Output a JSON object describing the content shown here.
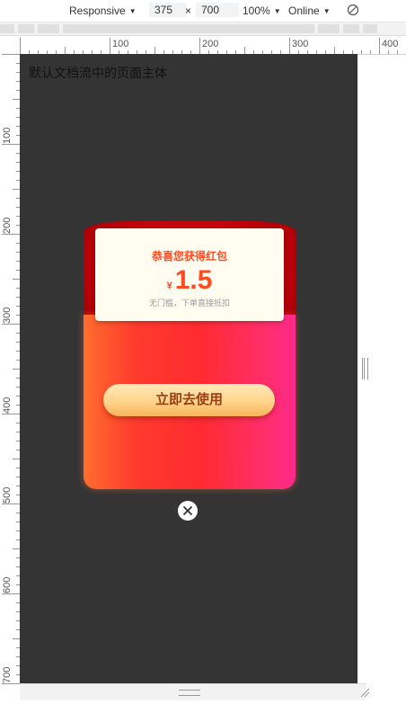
{
  "toolbar": {
    "device_mode": "Responsive",
    "width": "375",
    "times": "×",
    "height": "700",
    "zoom": "100%",
    "throttle": "Online",
    "rotate_icon": "rotate-icon"
  },
  "rulers": {
    "horizontal": [
      "100",
      "200",
      "300",
      "400"
    ],
    "vertical": [
      "100",
      "200",
      "300",
      "400",
      "500",
      "600",
      "700"
    ]
  },
  "page": {
    "body_text": "默认文档流中的页面主体"
  },
  "coupon": {
    "title": "恭喜您获得红包",
    "currency_symbol": "¥",
    "amount": "1.5",
    "subtitle": "无门槛，下单直接抵扣",
    "button_label": "立即去使用",
    "close_icon": "close-icon"
  },
  "colors": {
    "page_background": "#343434",
    "envelope_red": "#ff2b30",
    "envelope_dark": "#b30008",
    "card_background": "#fffdf0",
    "amount_color": "#ff4b22",
    "button_gold": "#ffd48c",
    "button_text": "#9a3d13"
  }
}
